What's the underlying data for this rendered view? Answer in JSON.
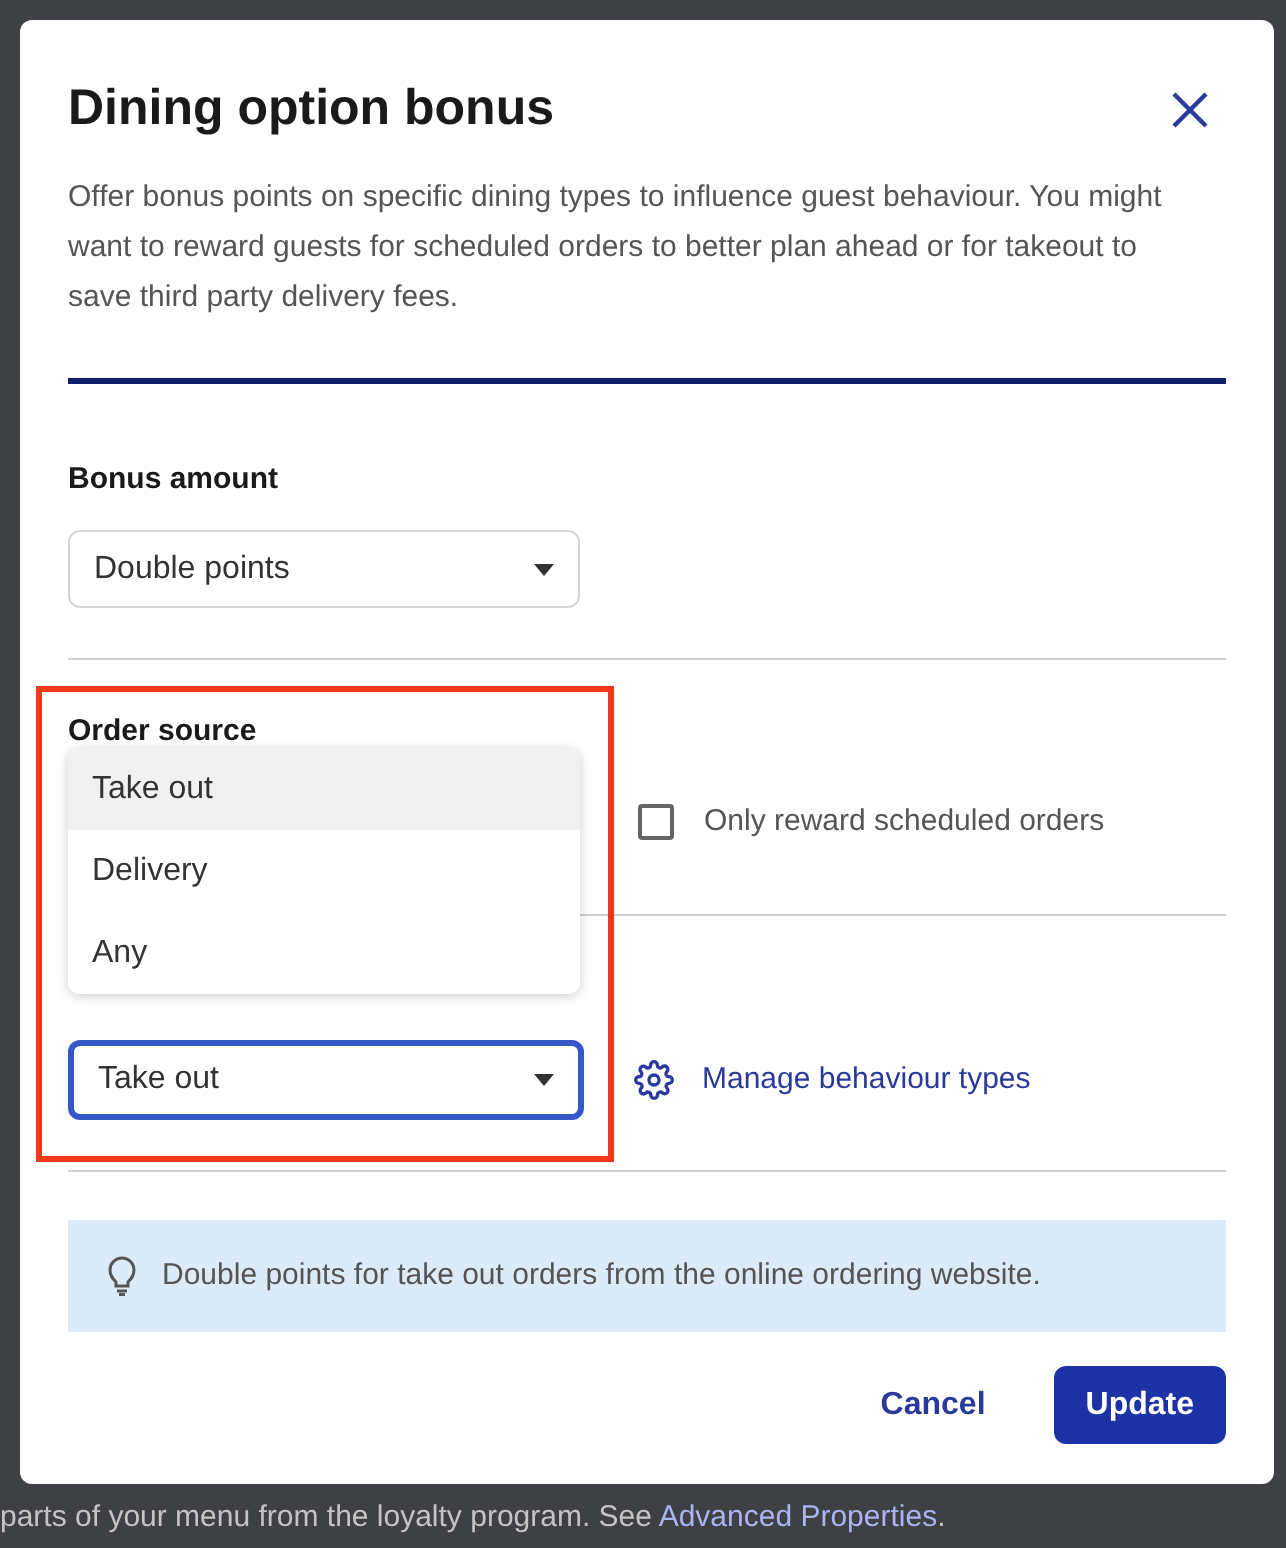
{
  "dialog": {
    "title": "Dining option bonus",
    "description": "Offer bonus points on specific dining types to influence guest behaviour. You might want to reward guests for scheduled orders to better plan ahead or for takeout to save third party delivery fees.",
    "bonus_amount": {
      "label": "Bonus amount",
      "value": "Double points"
    },
    "order_source": {
      "label": "Order source",
      "menu": [
        {
          "label": "Take out",
          "selected": true
        },
        {
          "label": "Delivery",
          "selected": false
        },
        {
          "label": "Any",
          "selected": false
        }
      ],
      "checkbox": {
        "label": "Only reward scheduled orders",
        "checked": false
      }
    },
    "section_3": {
      "select": {
        "value": "Take out",
        "focused": true
      },
      "link": "Manage behaviour types"
    },
    "hint": "Double points for take out orders from the online ordering website.",
    "buttons": [
      {
        "label": "Cancel",
        "kind": "text"
      },
      {
        "label": "Update",
        "kind": "primary"
      }
    ]
  },
  "background": {
    "text": "parts of your menu from the loyalty program. See ",
    "link": "Advanced Properties",
    "text_end": "."
  }
}
